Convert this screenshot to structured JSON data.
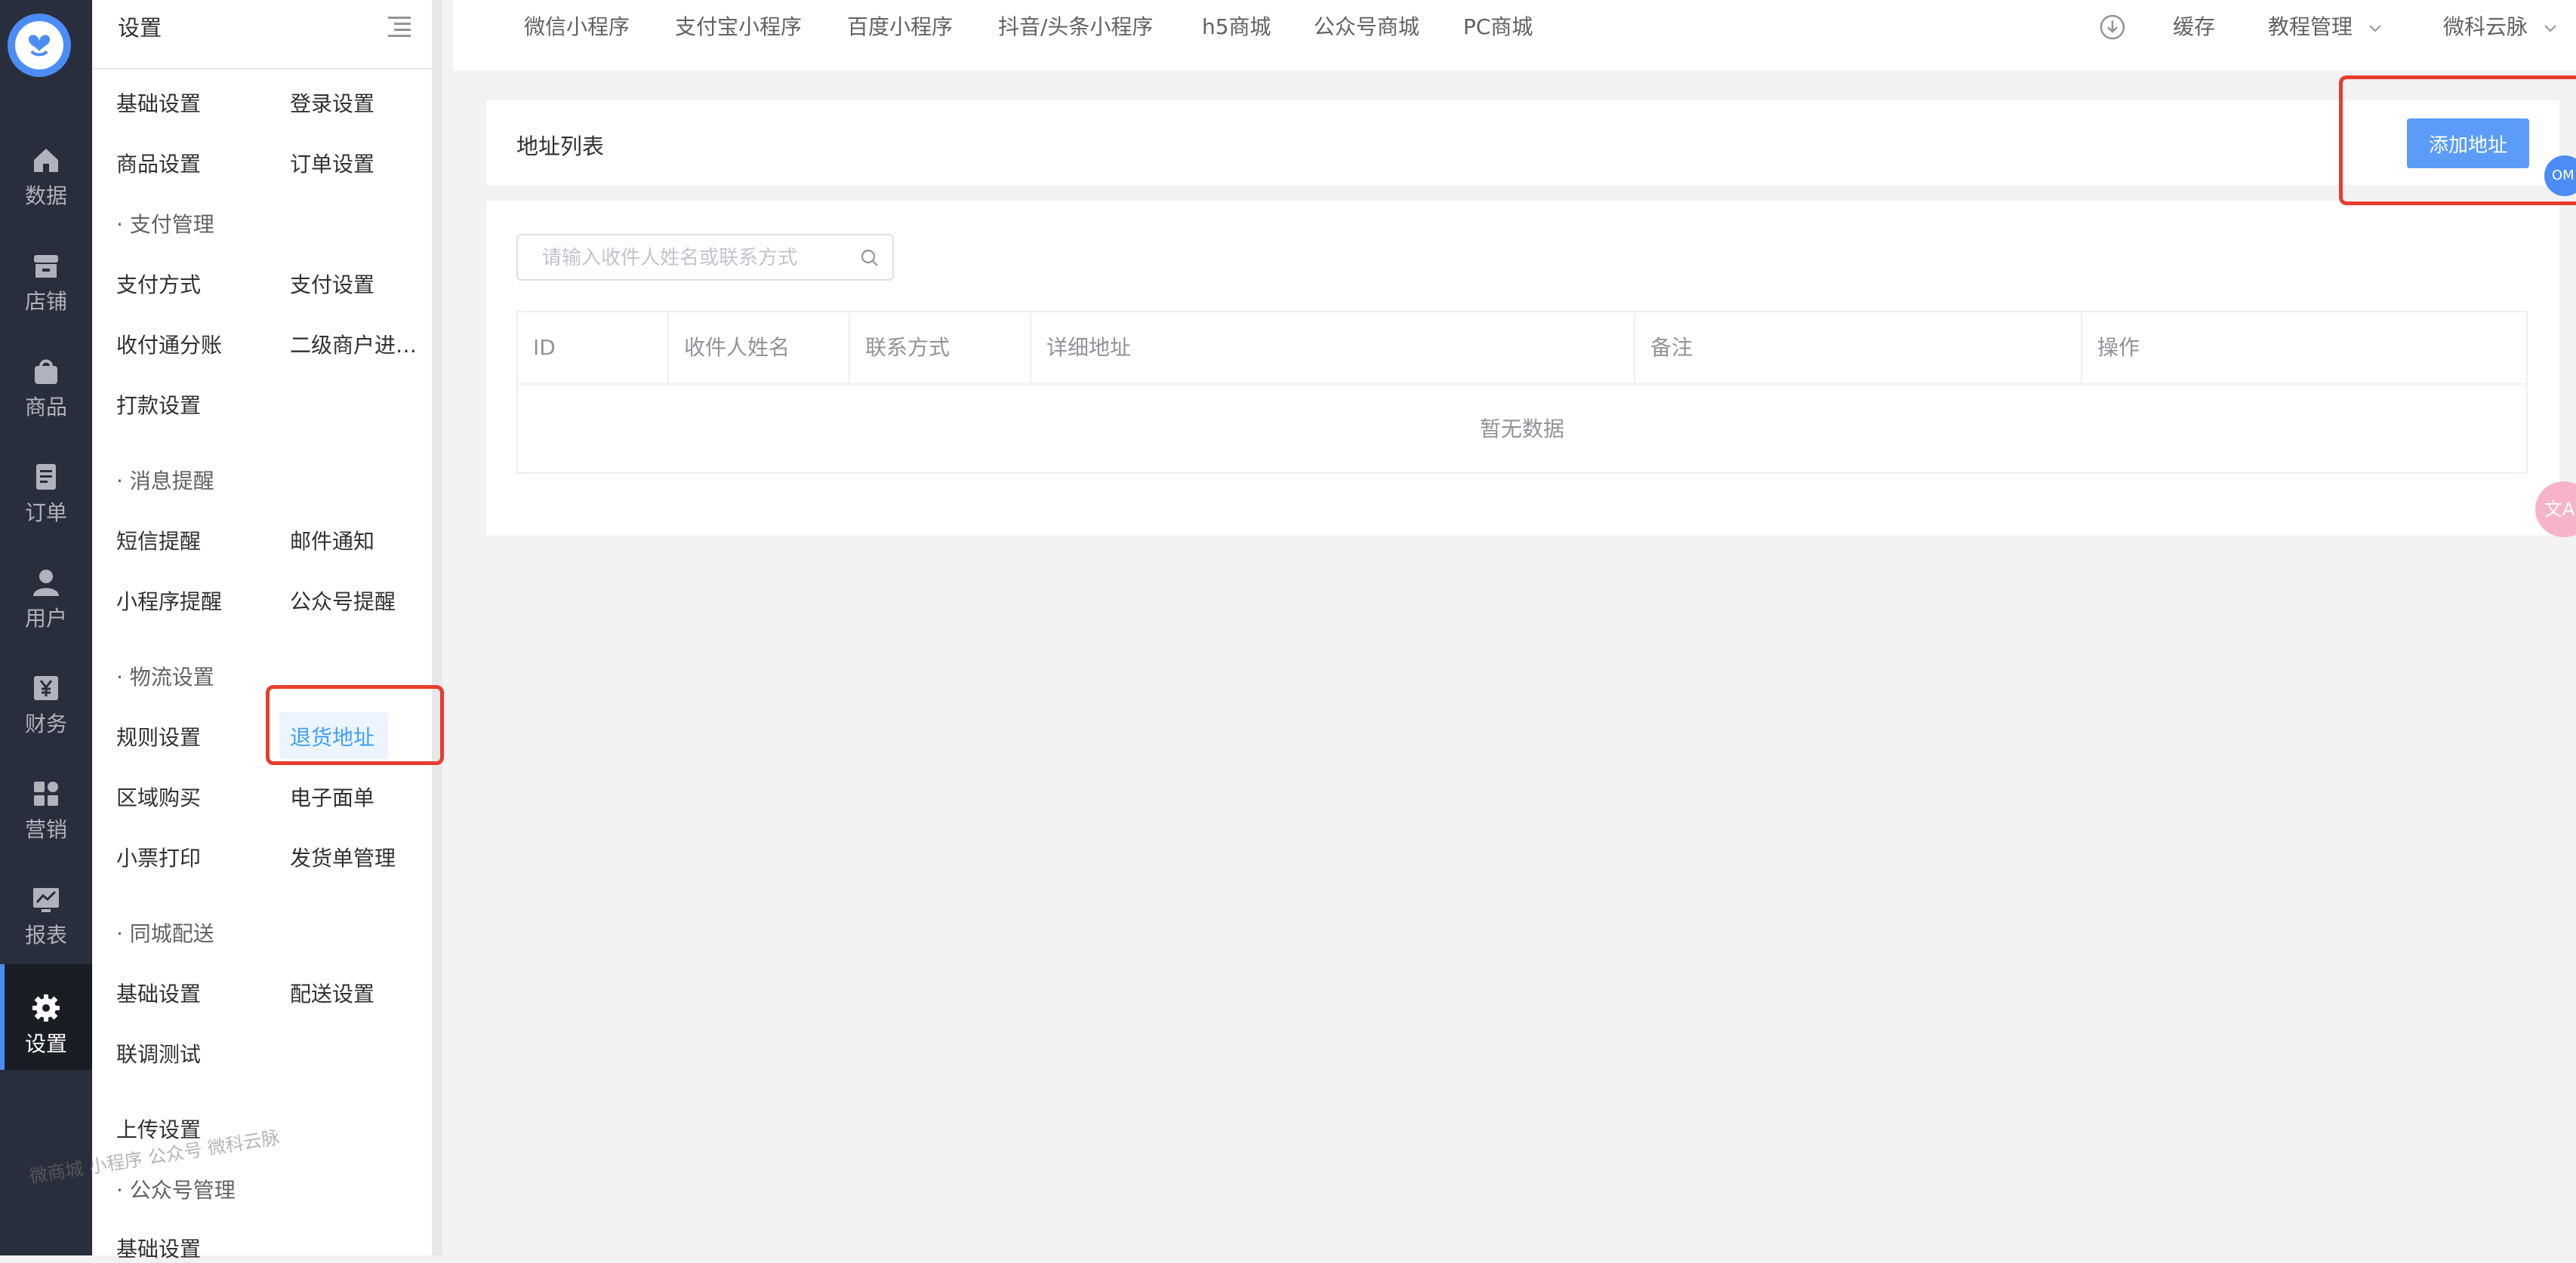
{
  "colors": {
    "rail_bg": "#282e3b",
    "rail_active_bg": "#1a1d24",
    "accent": "#409eff",
    "primary_button": "#5a9cf8",
    "highlight_box": "#e63d2f"
  },
  "rail": {
    "items": [
      {
        "label": "数据",
        "icon": "home-icon"
      },
      {
        "label": "店铺",
        "icon": "store-icon"
      },
      {
        "label": "商品",
        "icon": "shopping-bag-icon"
      },
      {
        "label": "订单",
        "icon": "document-icon"
      },
      {
        "label": "用户",
        "icon": "user-icon"
      },
      {
        "label": "财务",
        "icon": "yen-icon"
      },
      {
        "label": "营销",
        "icon": "grid-icon"
      },
      {
        "label": "报表",
        "icon": "chart-icon"
      },
      {
        "label": "设置",
        "icon": "gear-icon",
        "active": true
      }
    ]
  },
  "submenu": {
    "title": "设置",
    "rows": [
      {
        "left": "基础设置",
        "right": "登录设置"
      },
      {
        "left": "商品设置",
        "right": "订单设置"
      },
      {
        "group": "· 支付管理"
      },
      {
        "left": "支付方式",
        "right": "支付设置"
      },
      {
        "left": "收付通分账",
        "right": "二级商户进…"
      },
      {
        "left": "打款设置"
      },
      {
        "group": "· 消息提醒"
      },
      {
        "left": "短信提醒",
        "right": "邮件通知"
      },
      {
        "left": "小程序提醒",
        "right": "公众号提醒"
      },
      {
        "group": "· 物流设置"
      },
      {
        "left": "规则设置",
        "right": "退货地址"
      },
      {
        "left": "区域购买",
        "right": "电子面单"
      },
      {
        "left": "小票打印",
        "right": "发货单管理"
      },
      {
        "group": "· 同城配送"
      },
      {
        "left": "基础设置",
        "right": "配送设置"
      },
      {
        "left": "联调测试"
      },
      {
        "left": "上传设置"
      },
      {
        "group": "· 公众号管理"
      },
      {
        "left": "基础设置"
      }
    ]
  },
  "topbar": {
    "tabs": [
      "微信小程序",
      "支付宝小程序",
      "百度小程序",
      "抖音/头条小程序",
      "h5商城",
      "公众号商城",
      "PC商城"
    ],
    "cache": "缓存",
    "tutorial": "教程管理",
    "user": "微科云脉"
  },
  "main": {
    "title": "地址列表",
    "add_button": "添加地址",
    "search_placeholder": "请输入收件人姓名或联系方式",
    "columns": [
      "ID",
      "收件人姓名",
      "联系方式",
      "详细地址",
      "备注",
      "操作"
    ],
    "empty_text": "暂无数据"
  },
  "floating": {
    "om_label": "OM",
    "translate_label": "文A"
  },
  "watermark": "微商城 小程序 公众号 微科云脉"
}
